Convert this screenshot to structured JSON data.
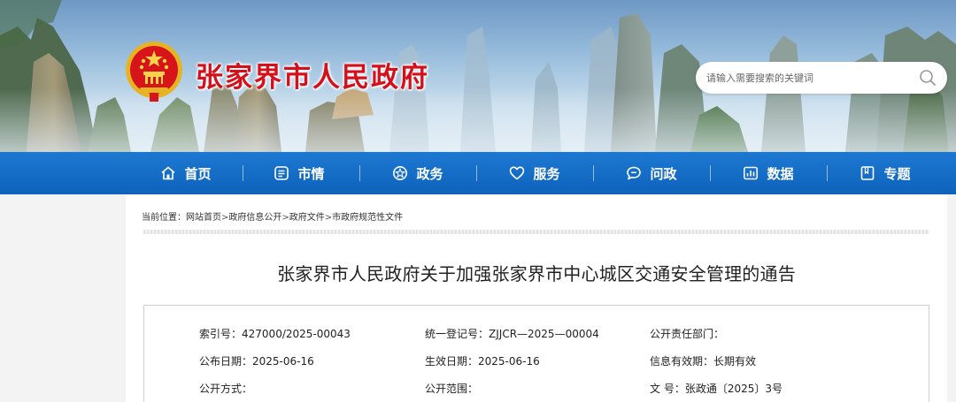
{
  "header": {
    "site_title": "张家界市人民政府",
    "search_placeholder": "请输入需要搜索的关键词"
  },
  "nav": [
    {
      "label": "首页",
      "icon": "home-icon"
    },
    {
      "label": "市情",
      "icon": "city-info-icon"
    },
    {
      "label": "政务",
      "icon": "government-affairs-icon"
    },
    {
      "label": "服务",
      "icon": "heart-icon"
    },
    {
      "label": "问政",
      "icon": "chat-icon"
    },
    {
      "label": "数据",
      "icon": "bar-chart-icon"
    },
    {
      "label": "专题",
      "icon": "book-icon"
    }
  ],
  "breadcrumb": {
    "prefix": "当前位置：",
    "items": [
      "网站首页",
      "政府信息公开",
      "政府文件",
      "市政府规范性文件"
    ],
    "separator": ">"
  },
  "document": {
    "title": "张家界市人民政府关于加强张家界市中心城区交通安全管理的通告",
    "meta": {
      "index_no": {
        "label": "索引号：",
        "value": "427000/2025-00043"
      },
      "unified_reg_no": {
        "label": "统一登记号：",
        "value": "ZJJCR—2025—00004"
      },
      "responsible_dept": {
        "label": "公开责任部门：",
        "value": ""
      },
      "publish_date": {
        "label": "公布日期：",
        "value": "2025-06-16"
      },
      "effective_date": {
        "label": "生效日期：",
        "value": "2025-06-16"
      },
      "validity": {
        "label": "信息有效期：",
        "value": "长期有效"
      },
      "disclosure_method": {
        "label": "公开方式：",
        "value": ""
      },
      "disclosure_scope": {
        "label": "公开范围：",
        "value": ""
      },
      "doc_no": {
        "label": "文 号：",
        "value": "张政通〔2025〕3号"
      }
    }
  },
  "colors": {
    "nav_blue": "#1068c2",
    "title_red": "#d4111b"
  }
}
